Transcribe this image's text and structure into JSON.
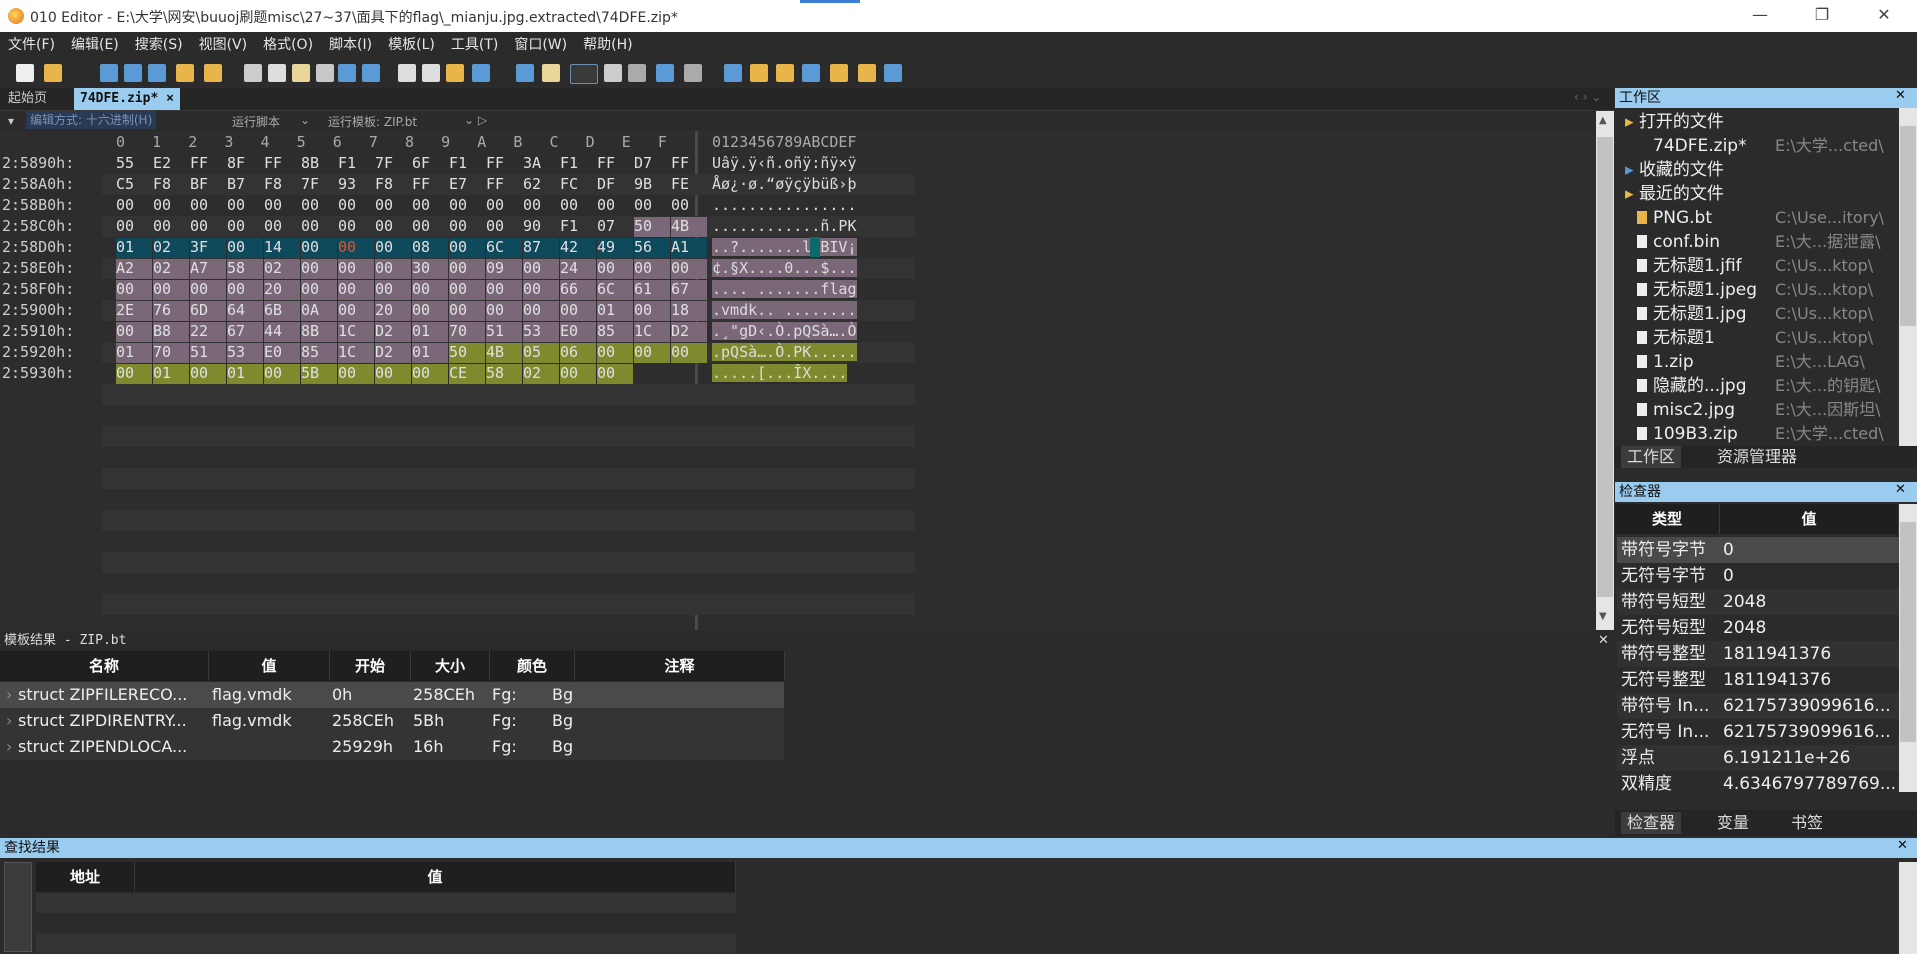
{
  "window": {
    "title": "010 Editor - E:\\大学\\网安\\buuoj刷题misc\\27~37\\面具下的flag\\_mianju.jpg.extracted\\74DFE.zip*",
    "minimize": "—",
    "restore": "❐",
    "close": "✕"
  },
  "menu": [
    "文件(F)",
    "编辑(E)",
    "搜索(S)",
    "视图(V)",
    "格式(O)",
    "脚本(I)",
    "模板(L)",
    "工具(T)",
    "窗口(W)",
    "帮助(H)"
  ],
  "tabs": [
    {
      "label": "起始页"
    },
    {
      "label": "74DFE.zip*",
      "close": "×"
    }
  ],
  "subbar": {
    "edit_mode": "编辑方式: 十六进制(H)",
    "run_script": "运行脚本",
    "run_template": "运行模板: ZIP.bt"
  },
  "hex": {
    "col_header": "0   1   2   3   4   5   6   7   8   9   A   B   C   D   E   F",
    "ascii_header": "0123456789ABCDEF",
    "rows": [
      {
        "addr": "2:5890h:",
        "bytes": [
          "55",
          "E2",
          "FF",
          "8F",
          "FF",
          "8B",
          "F1",
          "7F",
          "6F",
          "F1",
          "FF",
          "3A",
          "F1",
          "FF",
          "D7",
          "FF"
        ],
        "ascii": "Uâÿ.ÿ‹ñ.oñÿ:ñÿ×ÿ"
      },
      {
        "addr": "2:58A0h:",
        "bytes": [
          "C5",
          "F8",
          "BF",
          "B7",
          "F8",
          "7F",
          "93",
          "F8",
          "FF",
          "E7",
          "FF",
          "62",
          "FC",
          "DF",
          "9B",
          "FE"
        ],
        "ascii": "Åø¿·ø.“øÿçÿbüß›þ"
      },
      {
        "addr": "2:58B0h:",
        "bytes": [
          "00",
          "00",
          "00",
          "00",
          "00",
          "00",
          "00",
          "00",
          "00",
          "00",
          "00",
          "00",
          "00",
          "00",
          "00",
          "00"
        ],
        "ascii": "................"
      },
      {
        "addr": "2:58C0h:",
        "bytes": [
          "00",
          "00",
          "00",
          "00",
          "00",
          "00",
          "00",
          "00",
          "00",
          "00",
          "00",
          "90",
          "F1",
          "07",
          "50",
          "4B"
        ],
        "ascii": "............ñ.PK"
      },
      {
        "addr": "2:58D0h:",
        "bytes": [
          "01",
          "02",
          "3F",
          "00",
          "14",
          "00",
          "00",
          "00",
          "08",
          "00",
          "6C",
          "87",
          "42",
          "49",
          "56",
          "A1"
        ],
        "ascii": "..?.......l‡BIV¡"
      },
      {
        "addr": "2:58E0h:",
        "bytes": [
          "A2",
          "02",
          "A7",
          "58",
          "02",
          "00",
          "00",
          "00",
          "30",
          "00",
          "09",
          "00",
          "24",
          "00",
          "00",
          "00"
        ],
        "ascii": "¢.§X....0...$..."
      },
      {
        "addr": "2:58F0h:",
        "bytes": [
          "00",
          "00",
          "00",
          "00",
          "20",
          "00",
          "00",
          "00",
          "00",
          "00",
          "00",
          "00",
          "66",
          "6C",
          "61",
          "67"
        ],
        "ascii": ".... .......flag"
      },
      {
        "addr": "2:5900h:",
        "bytes": [
          "2E",
          "76",
          "6D",
          "64",
          "6B",
          "0A",
          "00",
          "20",
          "00",
          "00",
          "00",
          "00",
          "00",
          "01",
          "00",
          "18"
        ],
        "ascii": ".vmdk.. ........"
      },
      {
        "addr": "2:5910h:",
        "bytes": [
          "00",
          "B8",
          "22",
          "67",
          "44",
          "8B",
          "1C",
          "D2",
          "01",
          "70",
          "51",
          "53",
          "E0",
          "85",
          "1C",
          "D2"
        ],
        "ascii": ".¸\"gD‹.Ò.pQSà….Ò"
      },
      {
        "addr": "2:5920h:",
        "bytes": [
          "01",
          "70",
          "51",
          "53",
          "E0",
          "85",
          "1C",
          "D2",
          "01",
          "50",
          "4B",
          "05",
          "06",
          "00",
          "00",
          "00"
        ],
        "ascii": ".pQSà….Ò.PK....."
      },
      {
        "addr": "2:5930h:",
        "bytes": [
          "00",
          "01",
          "00",
          "01",
          "00",
          "5B",
          "00",
          "00",
          "00",
          "CE",
          "58",
          "02",
          "00",
          "00",
          "",
          " "
        ],
        "ascii": ".....[...ÎX...."
      }
    ]
  },
  "template_results": {
    "title": "模板结果 - ZIP.bt",
    "columns": [
      "名称",
      "值",
      "开始",
      "大小",
      "颜色",
      "注释"
    ],
    "rows": [
      {
        "name": "struct ZIPFILERECO...",
        "value": "flag.vmdk",
        "start": "0h",
        "size": "258CEh",
        "fg": "Fg:",
        "bg": "Bg"
      },
      {
        "name": "struct ZIPDIRENTRY...",
        "value": "flag.vmdk",
        "start": "258CEh",
        "size": "5Bh",
        "fg": "Fg:",
        "bg": "Bg"
      },
      {
        "name": "struct ZIPENDLOCA...",
        "value": "",
        "start": "25929h",
        "size": "16h",
        "fg": "Fg:",
        "bg": "Bg"
      }
    ]
  },
  "find_results": {
    "title": "查找结果",
    "columns": [
      "地址",
      "值"
    ]
  },
  "workspace": {
    "title": "工作区",
    "groups": {
      "open": "打开的文件",
      "favorites": "收藏的文件",
      "recent": "最近的文件"
    },
    "open_files": [
      {
        "name": "74DFE.zip*",
        "path": "E:\\大学...cted\\"
      }
    ],
    "recent_files": [
      {
        "name": "PNG.bt",
        "path": "C:\\Use...itory\\"
      },
      {
        "name": "conf.bin",
        "path": "E:\\大...据泄露\\"
      },
      {
        "name": "无标题1.jfif",
        "path": "C:\\Us...ktop\\"
      },
      {
        "name": "无标题1.jpeg",
        "path": "C:\\Us...ktop\\"
      },
      {
        "name": "无标题1.jpg",
        "path": "C:\\Us...ktop\\"
      },
      {
        "name": "无标题1",
        "path": "C:\\Us...ktop\\"
      },
      {
        "name": "1.zip",
        "path": "E:\\大...LAG\\"
      },
      {
        "name": "隐藏的...jpg",
        "path": "E:\\大...的钥匙\\"
      },
      {
        "name": "misc2.jpg",
        "path": "E:\\大...因斯坦\\"
      },
      {
        "name": "109B3.zip",
        "path": "E:\\大学...cted\\"
      }
    ],
    "tabs": [
      "工作区",
      "资源管理器"
    ]
  },
  "inspector": {
    "title": "检查器",
    "columns": [
      "类型",
      "值"
    ],
    "rows": [
      {
        "type": "带符号字节",
        "value": "0"
      },
      {
        "type": "无符号字节",
        "value": "0"
      },
      {
        "type": "带符号短型",
        "value": "2048"
      },
      {
        "type": "无符号短型",
        "value": "2048"
      },
      {
        "type": "带符号整型",
        "value": "1811941376"
      },
      {
        "type": "无符号整型",
        "value": "1811941376"
      },
      {
        "type": "带符号 In...",
        "value": "62175739099616..."
      },
      {
        "type": "无符号 In...",
        "value": "62175739099616..."
      },
      {
        "type": "浮点",
        "value": "6.191211e+26"
      },
      {
        "type": "双精度",
        "value": "4.6346797789769..."
      }
    ],
    "tabs": [
      "检查器",
      "变量",
      "书签"
    ]
  },
  "colors": {
    "accent": "#99ccee",
    "purple_sel": "#7a6879",
    "olive_sel": "#7f8a2e",
    "teal_sel": "#0b6b6b",
    "cursor_red": "#e0542a"
  }
}
